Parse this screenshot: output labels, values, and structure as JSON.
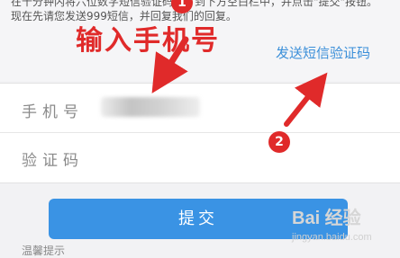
{
  "notice": {
    "line1": "在十分钟内将六位数字短信验证码填写到下方空白栏中，并点击\"提交\"按钮。",
    "line2": "现在先请您发送999短信，并回复我们的回复。"
  },
  "form": {
    "phone_label": "手机号",
    "code_label": "验证码",
    "send_code_link": "发送短信验证码"
  },
  "submit": {
    "label": "提交"
  },
  "bottom_hint": "温馨提示",
  "annotations": {
    "title": "输入手机号",
    "badge1": "1",
    "badge2": "2",
    "color": "#e02a2a"
  },
  "watermark": {
    "logo": "Bai 经验",
    "url": "jingyan.baidu.com"
  },
  "colors": {
    "accent": "#3a93e4",
    "link": "#3b8fd9",
    "annotation": "#e02a2a"
  }
}
